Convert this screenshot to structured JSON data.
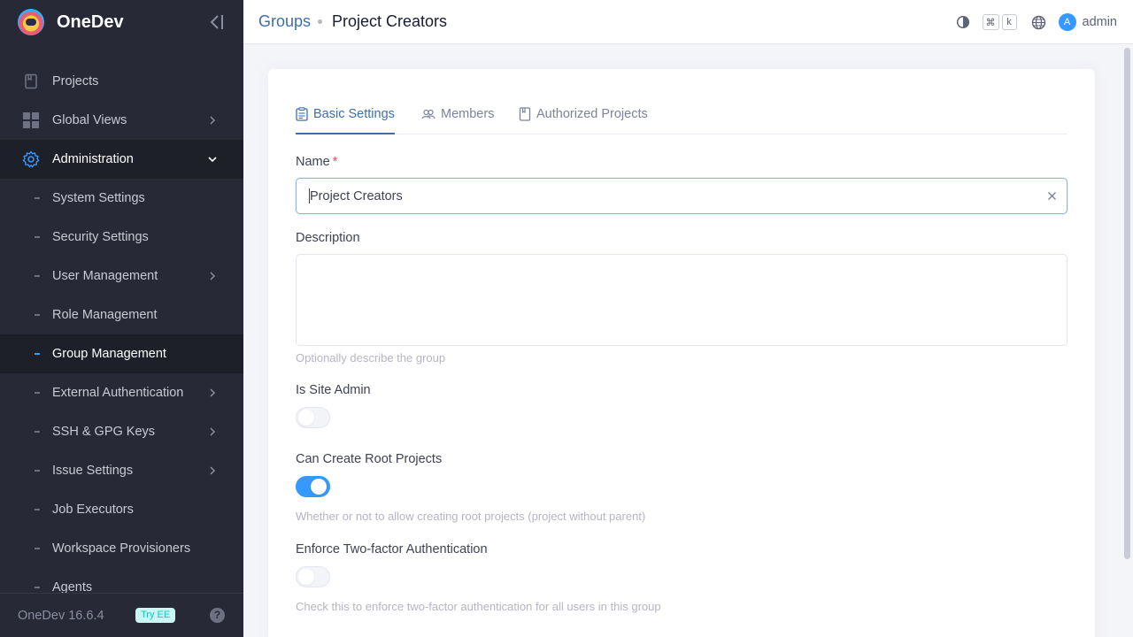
{
  "app": {
    "name": "OneDev",
    "version": "OneDev 16.6.4",
    "try_ee": "Try EE",
    "help": "?"
  },
  "sidebar": {
    "items": [
      {
        "label": "Projects",
        "icon": "projects-icon"
      },
      {
        "label": "Global Views",
        "icon": "grid-icon"
      },
      {
        "label": "Administration",
        "icon": "gear-icon"
      }
    ],
    "admin_items": [
      {
        "label": "System Settings"
      },
      {
        "label": "Security Settings"
      },
      {
        "label": "User Management"
      },
      {
        "label": "Role Management"
      },
      {
        "label": "Group Management"
      },
      {
        "label": "External Authentication"
      },
      {
        "label": "SSH & GPG Keys"
      },
      {
        "label": "Issue Settings"
      },
      {
        "label": "Job Executors"
      },
      {
        "label": "Workspace Provisioners"
      },
      {
        "label": "Agents"
      }
    ]
  },
  "header": {
    "breadcrumb_parent": "Groups",
    "breadcrumb_current": "Project Creators",
    "kbd_cmd": "⌘",
    "kbd_k": "k",
    "avatar_initial": "A",
    "username": "admin"
  },
  "tabs": [
    {
      "label": "Basic Settings",
      "active": true
    },
    {
      "label": "Members",
      "active": false
    },
    {
      "label": "Authorized Projects",
      "active": false
    }
  ],
  "form": {
    "name_label": "Name",
    "required_mark": "*",
    "name_value": "Project Creators",
    "description_label": "Description",
    "description_value": "",
    "description_help": "Optionally describe the group",
    "site_admin_label": "Is Site Admin",
    "site_admin_on": false,
    "create_root_label": "Can Create Root Projects",
    "create_root_on": true,
    "create_root_help": "Whether or not to allow creating root projects (project without parent)",
    "two_factor_label": "Enforce Two-factor Authentication",
    "two_factor_on": false,
    "two_factor_help": "Check this to enforce two-factor authentication for all users in this group"
  },
  "colors": {
    "accent": "#3699ff",
    "link": "#3f6fa8",
    "sidebar_bg": "#272a36"
  }
}
